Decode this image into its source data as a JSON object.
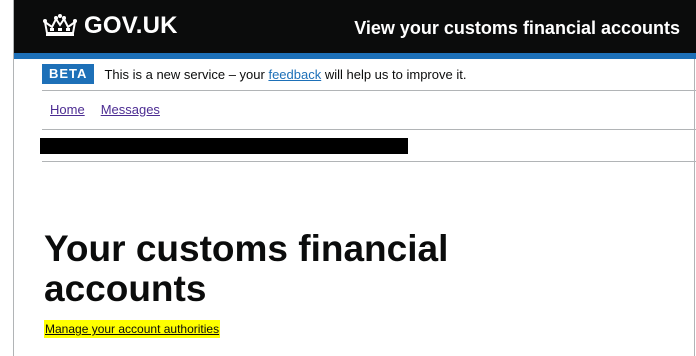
{
  "header": {
    "logo_text": "GOV.UK",
    "service_name": "View your customs financial accounts",
    "colors": {
      "background": "#0b0c0c",
      "accent": "#1d70b8"
    }
  },
  "phase_banner": {
    "tag": "BETA",
    "text_before": "This is a new service – your ",
    "link": "feedback",
    "text_after": " will help us to improve it."
  },
  "nav": {
    "items": [
      {
        "label": "Home"
      },
      {
        "label": "Messages"
      }
    ]
  },
  "main": {
    "title": "Your customs financial accounts",
    "manage_link": "Manage your account authorities",
    "highlight_color": "#ffff00"
  },
  "icons": {
    "logo": "crown-icon"
  }
}
